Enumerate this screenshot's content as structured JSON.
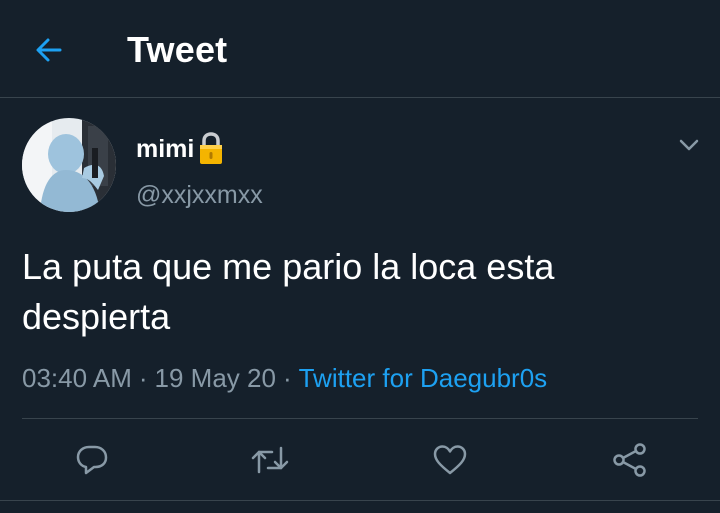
{
  "colors": {
    "background": "#15202b",
    "accent": "#1da1f2",
    "secondary_text": "#8899a6",
    "divider": "#38444d"
  },
  "header": {
    "back_icon": "arrow-left-icon",
    "title": "Tweet"
  },
  "tweet": {
    "author": {
      "display_name": "mimi",
      "badge_icon": "lock-emoji-icon",
      "handle": "@xxjxxmxx"
    },
    "menu_icon": "chevron-down-icon",
    "text": "La puta que me pario la loca esta despierta",
    "time": "03:40 AM",
    "date": "19 May 20",
    "separator": "·",
    "source": "Twitter for Daegubr0s"
  },
  "actions": [
    {
      "name": "reply",
      "icon": "reply-icon"
    },
    {
      "name": "retweet",
      "icon": "retweet-icon"
    },
    {
      "name": "like",
      "icon": "heart-icon"
    },
    {
      "name": "share",
      "icon": "share-icon"
    }
  ]
}
